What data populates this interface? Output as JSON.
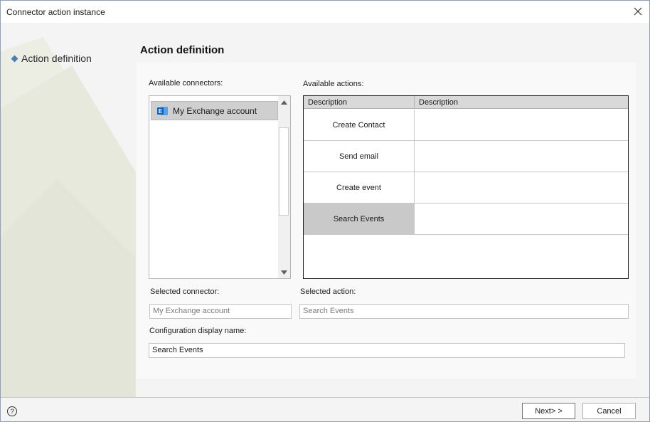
{
  "window": {
    "title": "Connector action instance"
  },
  "nav": {
    "items": [
      {
        "label": "Action definition",
        "icon": "diamond-bullet-icon"
      }
    ]
  },
  "section": {
    "title": "Action definition"
  },
  "connectors": {
    "label": "Available connectors:",
    "items": [
      {
        "label": "My Exchange account",
        "icon": "exchange-icon"
      }
    ]
  },
  "actions": {
    "label": "Available actions:",
    "columns": [
      "Description",
      "Description"
    ],
    "rows": [
      {
        "name": "Create Contact",
        "description": ""
      },
      {
        "name": "Send email",
        "description": ""
      },
      {
        "name": "Create event",
        "description": ""
      },
      {
        "name": "Search Events",
        "description": ""
      }
    ],
    "selected": "Search Events"
  },
  "selected_connector": {
    "label": "Selected connector:",
    "placeholder": "My Exchange account"
  },
  "selected_action": {
    "label": "Selected action:",
    "placeholder": "Search Events"
  },
  "config_name": {
    "label": "Configuration display name:",
    "value": "Search Events"
  },
  "footer": {
    "help_icon": "help-icon",
    "next_label": "Next> >",
    "cancel_label": "Cancel"
  },
  "colors": {
    "accent": "#4a7cc0",
    "selection": "#cfcfcf",
    "exchange": "#0a64c8"
  }
}
